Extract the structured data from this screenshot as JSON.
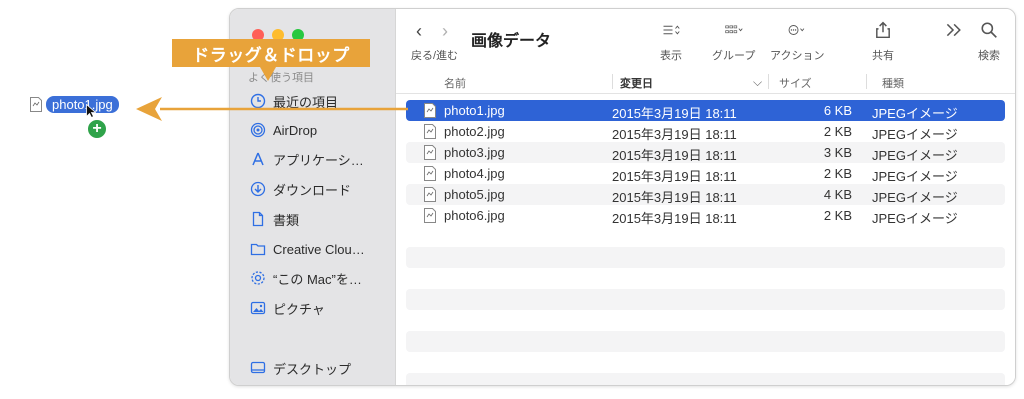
{
  "annotation": {
    "label": "ドラッグ＆ドロップ",
    "color": "#e8a33a"
  },
  "drag": {
    "file_name": "photo1.jpg",
    "badge": "+"
  },
  "toolbar": {
    "back_forward_label": "戻る/進む",
    "folder_title": "画像データ",
    "view_label": "表示",
    "group_label": "グループ",
    "action_label": "アクション",
    "share_label": "共有",
    "search_label": "検索"
  },
  "sidebar": {
    "section_label": "よく使う項目",
    "items": [
      {
        "label": "最近の項目",
        "icon": "clock-icon"
      },
      {
        "label": "AirDrop",
        "icon": "airdrop-icon"
      },
      {
        "label": "アプリケーシ…",
        "icon": "applications-icon"
      },
      {
        "label": "ダウンロード",
        "icon": "download-icon"
      },
      {
        "label": "書類",
        "icon": "document-icon"
      },
      {
        "label": "Creative Clou…",
        "icon": "folder-icon"
      },
      {
        "label": "“この Mac”を…",
        "icon": "gear-icon"
      },
      {
        "label": "ピクチャ",
        "icon": "photo-icon"
      },
      {
        "label": "デスクトップ",
        "icon": "desktop-icon"
      }
    ]
  },
  "columns": {
    "name": "名前",
    "date": "変更日",
    "size": "サイズ",
    "kind": "種類"
  },
  "files": [
    {
      "name": "photo1.jpg",
      "date": "2015年3月19日 18:11",
      "size": "6 KB",
      "kind": "JPEGイメージ",
      "selected": true
    },
    {
      "name": "photo2.jpg",
      "date": "2015年3月19日 18:11",
      "size": "2 KB",
      "kind": "JPEGイメージ"
    },
    {
      "name": "photo3.jpg",
      "date": "2015年3月19日 18:11",
      "size": "3 KB",
      "kind": "JPEGイメージ"
    },
    {
      "name": "photo4.jpg",
      "date": "2015年3月19日 18:11",
      "size": "2 KB",
      "kind": "JPEGイメージ"
    },
    {
      "name": "photo5.jpg",
      "date": "2015年3月19日 18:11",
      "size": "4 KB",
      "kind": "JPEGイメージ"
    },
    {
      "name": "photo6.jpg",
      "date": "2015年3月19日 18:11",
      "size": "2 KB",
      "kind": "JPEGイメージ"
    }
  ],
  "colors": {
    "selection": "#2e63d6",
    "sidebar_icon": "#2f6fe4"
  }
}
